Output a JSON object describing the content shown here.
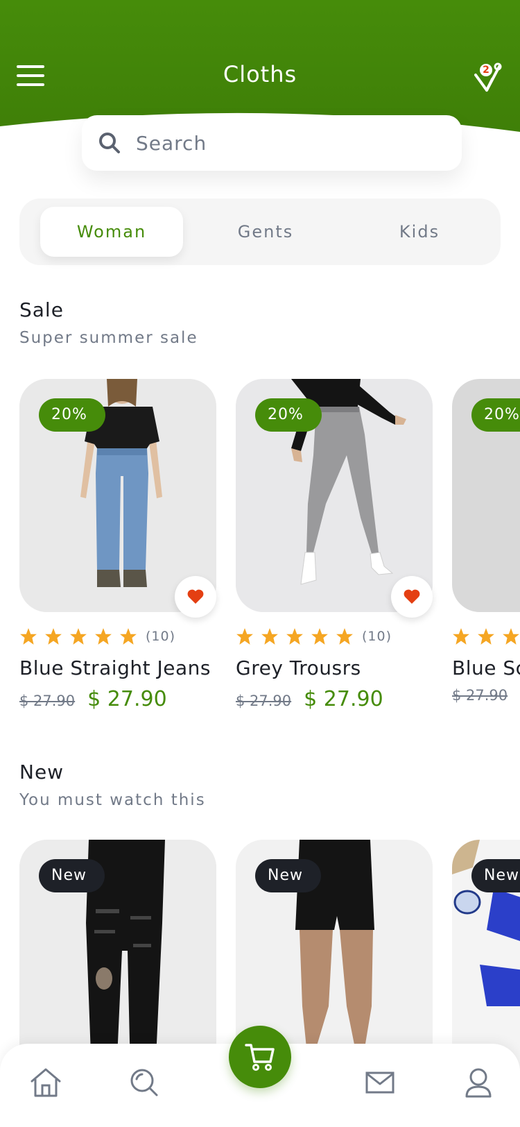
{
  "header": {
    "title": "Cloths",
    "notification_count": "2",
    "color": "#468c0a"
  },
  "search": {
    "placeholder": "Search"
  },
  "tabs": [
    {
      "label": "Woman",
      "active": true
    },
    {
      "label": "Gents",
      "active": false
    },
    {
      "label": "Kids",
      "active": false
    }
  ],
  "sale": {
    "title": "Sale",
    "subtitle": "Super summer sale",
    "products": [
      {
        "badge": "20%",
        "name": "Blue Straight Jeans",
        "old_price": "$ 27.90",
        "price": "$ 27.90",
        "rating": 5,
        "reviews": "(10)"
      },
      {
        "badge": "20%",
        "name": "Grey Trousrs",
        "old_price": "$ 27.90",
        "price": "$ 27.90",
        "rating": 5,
        "reviews": "(10)"
      },
      {
        "badge": "20%",
        "name": "Blue Sc",
        "old_price": "$ 27.90",
        "price": "",
        "rating": 5,
        "reviews": ""
      }
    ]
  },
  "new": {
    "title": "New",
    "subtitle": "You must watch this",
    "products": [
      {
        "badge": "New"
      },
      {
        "badge": "New"
      },
      {
        "badge": "New"
      }
    ]
  },
  "bottom_nav": {
    "items": [
      "home-icon",
      "search-icon",
      "cart-icon",
      "mail-icon",
      "profile-icon"
    ]
  },
  "colors": {
    "accent": "#468c0a",
    "dark": "#1e2128",
    "muted": "#727a88",
    "heart": "#e43f12",
    "star": "#f5a623"
  }
}
